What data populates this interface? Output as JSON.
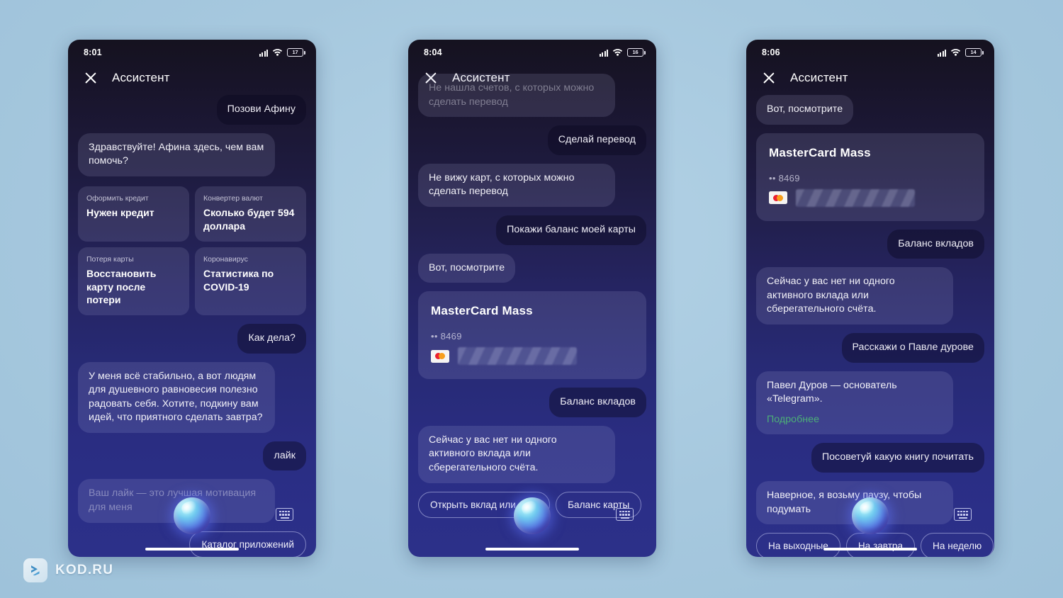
{
  "watermark": {
    "text": "KOD.RU"
  },
  "app": {
    "title": "Ассистент",
    "close_label": "×"
  },
  "phones": [
    {
      "id": "phone-1",
      "status": {
        "time": "8:01",
        "battery": "17"
      },
      "messages": [
        {
          "type": "user",
          "text": "Позови Афину"
        },
        {
          "type": "bot",
          "text": "Здравствуйте! Афина здесь, чем вам помочь?"
        },
        {
          "type": "suggestions",
          "cards": [
            {
              "kicker": "Оформить кредит",
              "title": "Нужен кредит"
            },
            {
              "kicker": "Конвертер валют",
              "title": "Сколько будет 594 доллара"
            },
            {
              "kicker": "Потеря карты",
              "title": "Восстановить карту после потери"
            },
            {
              "kicker": "Коронавирус",
              "title": "Статистика по COVID-19"
            }
          ]
        },
        {
          "type": "user",
          "text": "Как дела?"
        },
        {
          "type": "bot",
          "text": "У меня всё стабильно, а вот людям для душевного равновесия полезно радовать себя. Хотите, подкину вам идей, что приятного сделать завтра?"
        },
        {
          "type": "user",
          "text": "лайк"
        },
        {
          "type": "bot",
          "text": "Ваш лайк — это лучшая мотивация для меня",
          "faded": true
        }
      ],
      "pills": {
        "align": "right",
        "items": [
          "Каталог приложений"
        ]
      }
    },
    {
      "id": "phone-2",
      "status": {
        "time": "8:04",
        "battery": "16"
      },
      "messages": [
        {
          "type": "bot",
          "text": "Не нашла счетов, с которых можно сделать перевод",
          "faded": true
        },
        {
          "type": "user",
          "text": "Сделай перевод"
        },
        {
          "type": "bot",
          "text": "Не вижу карт, с которых можно сделать перевод"
        },
        {
          "type": "user",
          "text": "Покажи баланс моей карты"
        },
        {
          "type": "bot",
          "text": "Вот, посмотрите"
        },
        {
          "type": "card",
          "card": {
            "name": "MasterCard Mass",
            "mask": "•• 8469",
            "brand": "mastercard-logo"
          }
        },
        {
          "type": "user",
          "text": "Баланс вкладов"
        },
        {
          "type": "bot",
          "text": "Сейчас у вас нет ни одного активного вклада или сберегательного счёта."
        }
      ],
      "pills": {
        "align": "left",
        "items": [
          "Открыть вклад или счёт",
          "Баланс карты"
        ]
      }
    },
    {
      "id": "phone-3",
      "status": {
        "time": "8:06",
        "battery": "14"
      },
      "messages": [
        {
          "type": "bot",
          "text": "Вот, посмотрите"
        },
        {
          "type": "card",
          "card": {
            "name": "MasterCard Mass",
            "mask": "•• 8469",
            "brand": "mastercard-logo"
          }
        },
        {
          "type": "user",
          "text": "Баланс вкладов"
        },
        {
          "type": "bot",
          "text": "Сейчас у вас нет ни одного активного вклада или сберегательного счёта."
        },
        {
          "type": "user",
          "text": "Расскажи о Павле дурове"
        },
        {
          "type": "bot",
          "text": "Павел Дуров — основатель «Telegram».",
          "link": "Подробнее"
        },
        {
          "type": "user",
          "text": "Посоветуй какую книгу почитать"
        },
        {
          "type": "bot",
          "text": "Наверное, я возьму паузу, чтобы подумать",
          "faded_tail": true
        }
      ],
      "pills": {
        "align": "left",
        "items": [
          "На выходные",
          "На завтра",
          "На неделю"
        ]
      }
    }
  ],
  "colors": {
    "page_background": "#a6c8de",
    "screen_top": "#15121f",
    "screen_bottom": "#2c3089",
    "link_green": "#4caf77",
    "orb_core": "#5b7fe8"
  }
}
